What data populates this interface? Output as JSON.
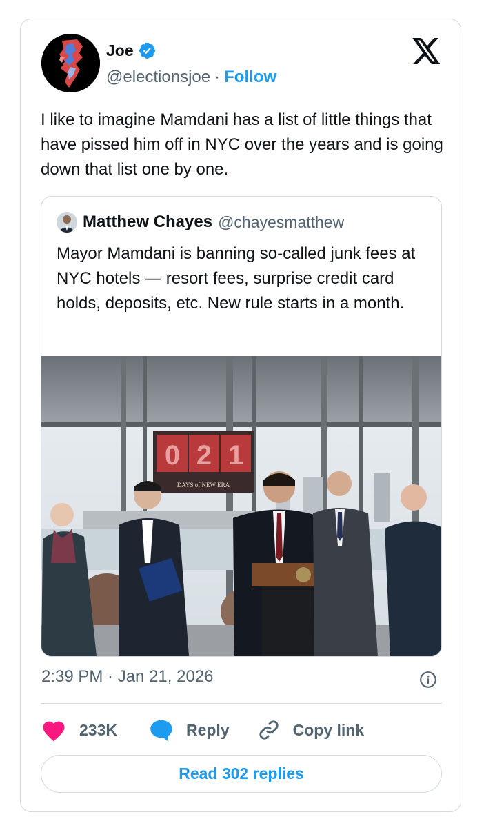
{
  "author": {
    "name": "Joe",
    "handle": "@electionsjoe",
    "separator": "·",
    "follow_label": "Follow",
    "verified": true
  },
  "platform_icon": "x-logo-icon",
  "tweet": {
    "text": "I like to imagine Mamdani has a list of little things that have pissed him off in NYC over the years and is going down that list one by one."
  },
  "quoted_tweet": {
    "name": "Matthew Chayes",
    "handle": "@chayesmatthew",
    "text": "Mayor Mamdani is banning so-called junk fees at NYC hotels — resort fees, surprise credit card holds, deposits, etc. New rule starts in a month.",
    "photo": {
      "sign_digits": [
        "0",
        "2",
        "1"
      ],
      "sign_caption": "DAYS of NEW ERA"
    }
  },
  "timestamp": "2:39 PM · Jan 21, 2026",
  "actions": {
    "likes_count": "233K",
    "reply_label": "Reply",
    "copy_link_label": "Copy link"
  },
  "read_replies_label": "Read 302 replies",
  "colors": {
    "accent": "#1d9bf0",
    "like": "#f91880",
    "text": "#0f1419",
    "secondary": "#536471",
    "border": "#cfd9de"
  }
}
